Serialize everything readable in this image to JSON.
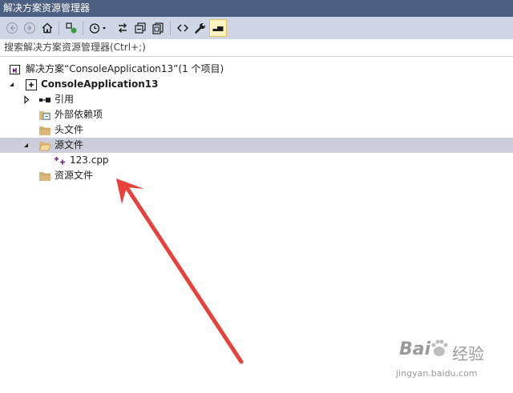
{
  "window": {
    "title": "解决方案资源管理器"
  },
  "toolbar": {
    "buttons": [
      {
        "name": "back-button",
        "icon": "back-icon"
      },
      {
        "name": "forward-button",
        "icon": "forward-icon"
      },
      {
        "name": "home-button",
        "icon": "home-icon"
      },
      {
        "name": "switch-views-button",
        "icon": "switch-views-icon"
      },
      {
        "name": "pending-changes-filter-button",
        "icon": "clock-filter-icon"
      },
      {
        "name": "sync-active-document-button",
        "icon": "sync-icon"
      },
      {
        "name": "collapse-all-button",
        "icon": "collapse-all-icon"
      },
      {
        "name": "show-all-files-button",
        "icon": "show-all-files-icon"
      },
      {
        "name": "view-code-button",
        "icon": "code-icon"
      },
      {
        "name": "properties-button",
        "icon": "wrench-icon"
      },
      {
        "name": "preview-selected-button",
        "icon": "preview-icon"
      }
    ]
  },
  "search": {
    "placeholder": "搜索解决方案资源管理器(Ctrl+;)"
  },
  "tree": {
    "solution": "解决方案“ConsoleApplication13”(1 个项目)",
    "project": "ConsoleApplication13",
    "references": "引用",
    "external_deps": "外部依赖项",
    "header_files": "头文件",
    "source_files": "源文件",
    "source_file_1": "123.cpp",
    "resource_files": "资源文件"
  },
  "watermark": {
    "brand_a": "Bai",
    "brand_b": "经验",
    "url": "jingyan.baidu.com"
  },
  "colors": {
    "title_bg": "#4d6082",
    "toolbar_bg": "#cfd6e5",
    "selection": "#cccedb",
    "folder": "#dcb67a",
    "cpp": "#68217a",
    "arrow": "#e8403a"
  }
}
